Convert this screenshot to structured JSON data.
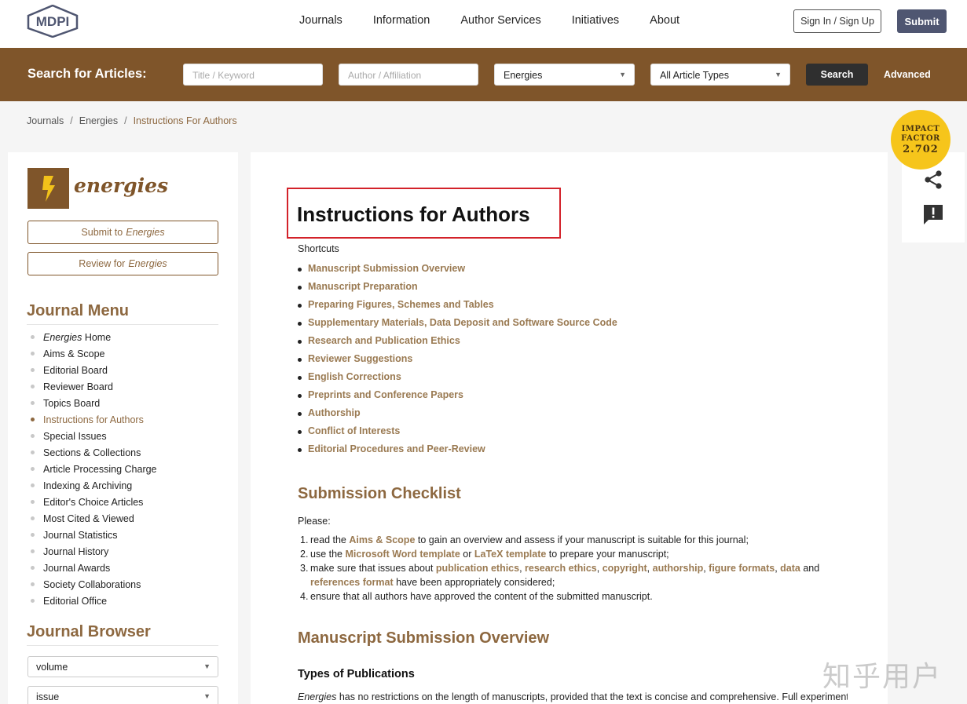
{
  "header": {
    "logo_text": "MDPI",
    "nav": [
      "Journals",
      "Information",
      "Author Services",
      "Initiatives",
      "About"
    ],
    "sign_in": "Sign In / Sign Up",
    "submit": "Submit"
  },
  "search": {
    "label": "Search for Articles:",
    "title_placeholder": "Title / Keyword",
    "author_placeholder": "Author / Affiliation",
    "journal_value": "Energies",
    "type_value": "All Article Types",
    "button": "Search",
    "advanced": "Advanced"
  },
  "breadcrumb": [
    "Journals",
    "Energies",
    "Instructions For Authors"
  ],
  "impact": {
    "line1": "IMPACT",
    "line2": "FACTOR",
    "value": "2.702"
  },
  "sidebar": {
    "journal_name": "energies",
    "submit_btn": {
      "prefix": "Submit to",
      "journal": "Energies"
    },
    "review_btn": {
      "prefix": "Review for",
      "journal": "Energies"
    },
    "menu_heading": "Journal Menu",
    "menu": [
      {
        "italic": "Energies",
        "label": " Home"
      },
      {
        "italic": "",
        "label": "Aims & Scope"
      },
      {
        "italic": "",
        "label": "Editorial Board"
      },
      {
        "italic": "",
        "label": "Reviewer Board"
      },
      {
        "italic": "",
        "label": "Topics Board"
      },
      {
        "italic": "",
        "label": "Instructions for Authors",
        "active": true
      },
      {
        "italic": "",
        "label": "Special Issues"
      },
      {
        "italic": "",
        "label": "Sections & Collections"
      },
      {
        "italic": "",
        "label": "Article Processing Charge"
      },
      {
        "italic": "",
        "label": "Indexing & Archiving"
      },
      {
        "italic": "",
        "label": "Editor's Choice Articles"
      },
      {
        "italic": "",
        "label": "Most Cited & Viewed"
      },
      {
        "italic": "",
        "label": "Journal Statistics"
      },
      {
        "italic": "",
        "label": "Journal History"
      },
      {
        "italic": "",
        "label": "Journal Awards"
      },
      {
        "italic": "",
        "label": "Society Collaborations"
      },
      {
        "italic": "",
        "label": "Editorial Office"
      }
    ],
    "browser_heading": "Journal Browser",
    "volume_value": "volume",
    "issue_value": "issue"
  },
  "main": {
    "title": "Instructions for Authors",
    "shortcuts_label": "Shortcuts",
    "shortcuts": [
      "Manuscript Submission Overview",
      "Manuscript Preparation",
      "Preparing Figures, Schemes and Tables",
      "Supplementary Materials, Data Deposit and Software Source Code",
      "Research and Publication Ethics",
      "Reviewer Suggestions",
      "English Corrections",
      "Preprints and Conference Papers",
      "Authorship",
      "Conflict of Interests",
      "Editorial Procedures and Peer-Review"
    ],
    "checklist_heading": "Submission Checklist",
    "please": "Please:",
    "checklist": [
      [
        [
          "t",
          "read the "
        ],
        [
          "l",
          "Aims & Scope"
        ],
        [
          "t",
          " to gain an overview and assess if your manuscript is suitable for this journal;"
        ]
      ],
      [
        [
          "t",
          "use the "
        ],
        [
          "l",
          "Microsoft Word template"
        ],
        [
          "t",
          " or "
        ],
        [
          "l",
          "LaTeX template"
        ],
        [
          "t",
          " to prepare your manuscript;"
        ]
      ],
      [
        [
          "t",
          "make sure that issues about "
        ],
        [
          "l",
          "publication ethics"
        ],
        [
          "t",
          ", "
        ],
        [
          "l",
          "research ethics"
        ],
        [
          "t",
          ", "
        ],
        [
          "l",
          "copyright"
        ],
        [
          "t",
          ", "
        ],
        [
          "l",
          "authorship"
        ],
        [
          "t",
          ", "
        ],
        [
          "l",
          "figure formats"
        ],
        [
          "t",
          ", "
        ],
        [
          "l",
          "data"
        ],
        [
          "t",
          " and "
        ],
        [
          "l",
          "references format"
        ],
        [
          "t",
          " have been appropriately considered;"
        ]
      ],
      [
        [
          "t",
          "ensure that all authors have approved the content of the submitted manuscript."
        ]
      ]
    ],
    "overview_heading": "Manuscript Submission Overview",
    "types_heading": "Types of Publications",
    "body_italic": "Energies",
    "body_text": " has no restrictions on the length of manuscripts, provided that the text is concise and comprehensive. Full experimental"
  },
  "watermark": "知乎用户",
  "colors": {
    "brand_brown": "#7f552a",
    "link": "#9a7a52",
    "highlight": "#d3222a",
    "impact": "#f6c51b"
  }
}
